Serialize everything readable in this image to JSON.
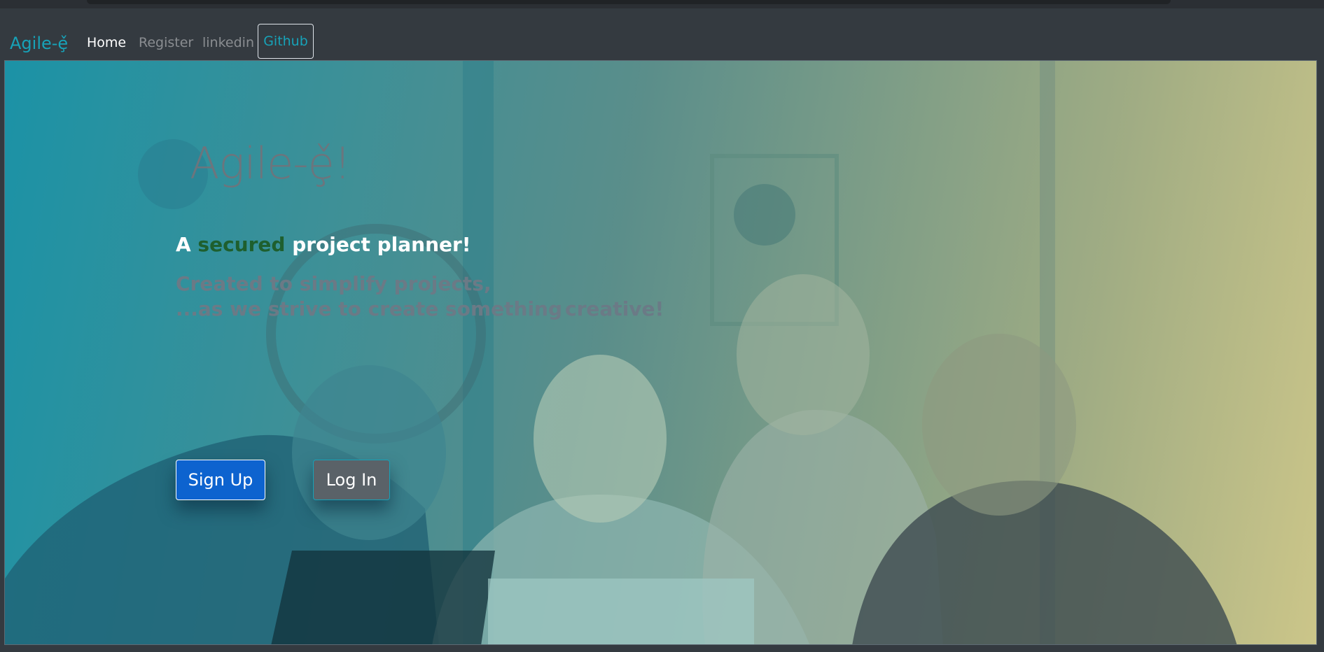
{
  "navbar": {
    "brand": "Agile-ȩ̌",
    "links": [
      {
        "label": "Home"
      },
      {
        "label": "Register"
      },
      {
        "label": "linkedin"
      },
      {
        "label": "Github"
      }
    ]
  },
  "hero": {
    "title": "Agile-ȩ̌!",
    "lead": {
      "prefix": "A",
      "emphasis": "secured",
      "suffix": "project planner!"
    },
    "sub_line_1": "Created to simplify projects,",
    "sub_line_2a": "...as we strive to create something",
    "sub_line_2b": "creative!",
    "signup_label": "Sign Up",
    "login_label": "Log In"
  },
  "colors": {
    "accent": "#17a2b8",
    "navbar": "#343a40",
    "signup": "#0d63cf",
    "login": "#5a6268",
    "secured": "#1e5f2e"
  }
}
